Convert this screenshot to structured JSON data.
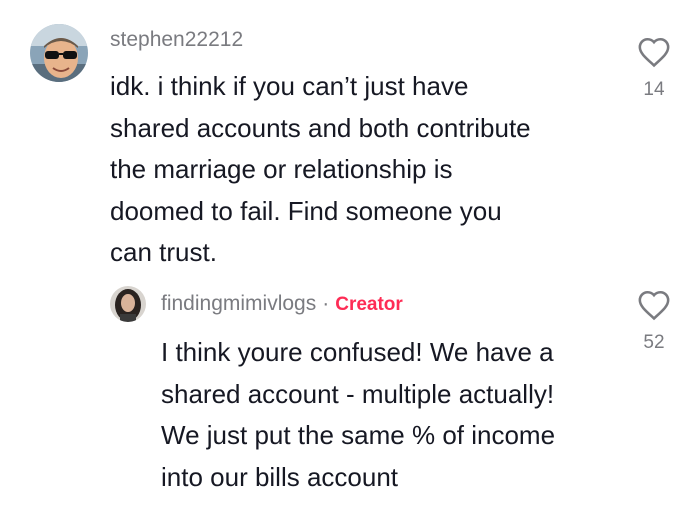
{
  "comments": [
    {
      "username": "stephen22212",
      "text": "idk. i think if you can’t just have\nshared accounts and both contribute\nthe marriage or relationship is\ndoomed to fail. Find someone you\ncan trust.",
      "likes": "14",
      "avatar_icon": "user-avatar-sunglasses"
    },
    {
      "username": "findingmimivlogs",
      "separator": "·",
      "badge": "Creator",
      "text": "I think youre confused! We have a\nshared account - multiple actually!\nWe just put the same % of income\ninto our bills account",
      "likes": "52",
      "avatar_icon": "user-avatar-dark-hair"
    }
  ],
  "colors": {
    "username": "#7a7b80",
    "text": "#161823",
    "creator_badge": "#fe2c55",
    "like_icon": "#7a7b80"
  },
  "icons": {
    "like": "heart-outline-icon"
  }
}
